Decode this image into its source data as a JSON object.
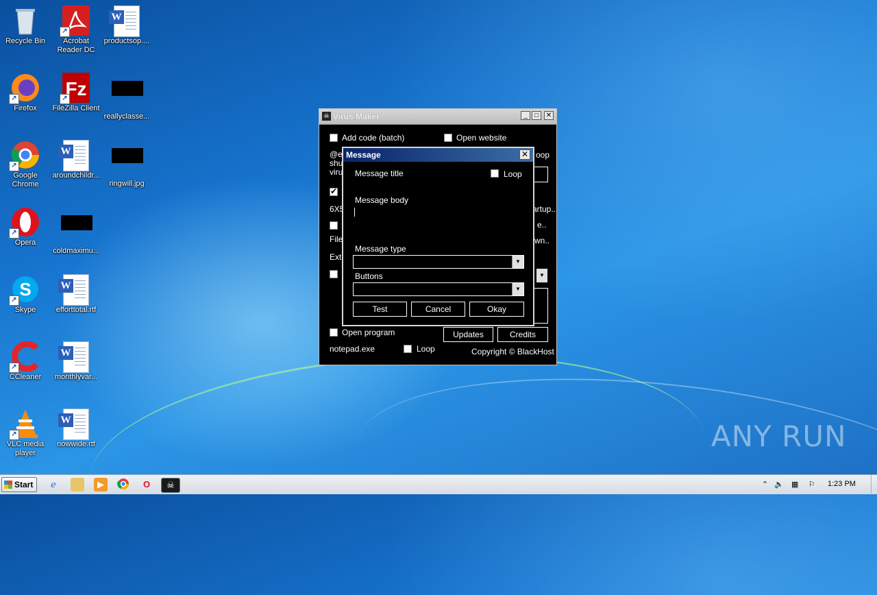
{
  "desktop": {
    "icons": [
      {
        "label": "Recycle Bin"
      },
      {
        "label": "Acrobat Reader DC"
      },
      {
        "label": "productsop...."
      },
      {
        "label": "Firefox"
      },
      {
        "label": "FileZilla Client"
      },
      {
        "label": "reallyclasse..."
      },
      {
        "label": "Google Chrome"
      },
      {
        "label": "aroundchildr..."
      },
      {
        "label": "ringwill.jpg"
      },
      {
        "label": "Opera"
      },
      {
        "label": "coldmaximu..."
      },
      {
        "label": "Skype"
      },
      {
        "label": "efforttotal.rtf"
      },
      {
        "label": "CCleaner"
      },
      {
        "label": "monthlyvar..."
      },
      {
        "label": "VLC media player"
      },
      {
        "label": "nowwide.rtf"
      }
    ]
  },
  "virus_maker": {
    "title": "Virus Maker",
    "add_code": "Add code (batch)",
    "open_website": "Open website",
    "code_lines": [
      "@e",
      "shu",
      "viru"
    ],
    "loop_partial": "oop",
    "row_6x5": "6X5",
    "startup_partial": "artup..",
    "file_partial": "File",
    "dots_partial": "e..",
    "down_partial": "wn..",
    "ext_partial": "Exte",
    "open_program": "Open program",
    "updates": "Updates",
    "credits": "Credits",
    "program_path": "notepad.exe",
    "loop": "Loop",
    "copyright": "Copyright © BlackHost"
  },
  "message_dialog": {
    "title": "Message",
    "message_title_label": "Message title",
    "loop_label": "Loop",
    "message_body_label": "Message body",
    "message_type_label": "Message type",
    "message_type_value": "",
    "buttons_label": "Buttons",
    "buttons_value": "",
    "test": "Test",
    "cancel": "Cancel",
    "okay": "Okay"
  },
  "taskbar": {
    "start": "Start",
    "clock": "1:23 PM"
  },
  "watermark": "ANY RUN"
}
